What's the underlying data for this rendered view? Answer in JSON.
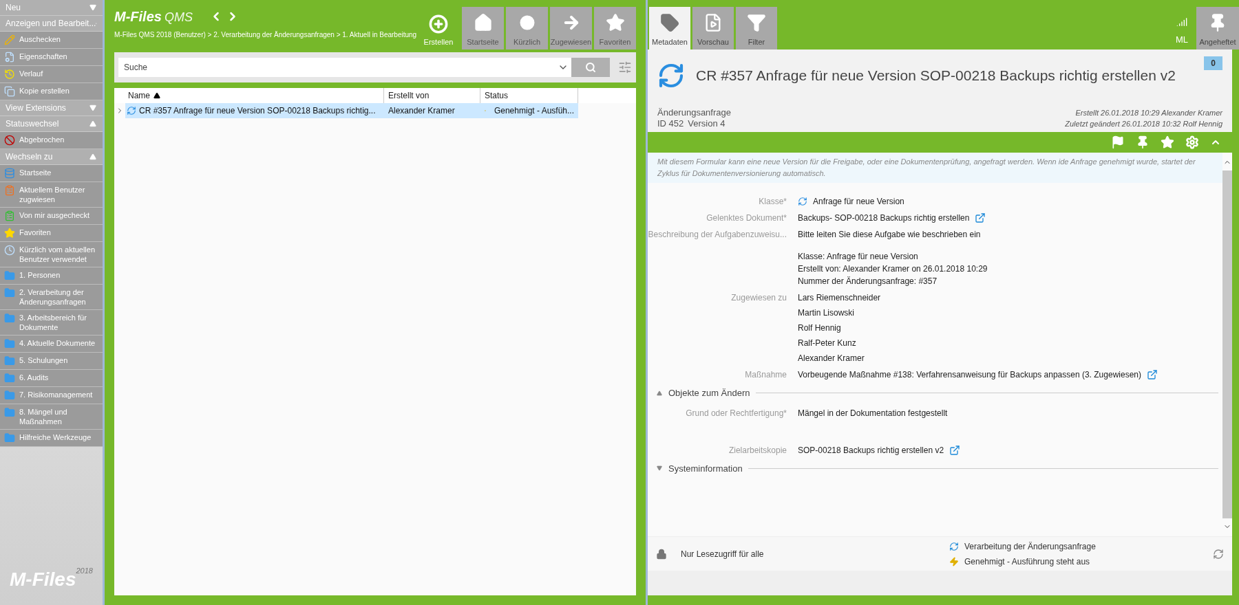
{
  "sidebar": {
    "sections": [
      {
        "title": "Neu",
        "expanded": false
      },
      {
        "title": "Anzeigen und Bearbeit...",
        "expanded": true,
        "items": [
          {
            "label": "Auschecken",
            "kind": "edit"
          },
          {
            "label": "Eigenschaften",
            "kind": "properties"
          },
          {
            "label": "Verlauf",
            "kind": "history"
          },
          {
            "label": "Kopie erstellen",
            "kind": "copy"
          }
        ]
      },
      {
        "title": "View Extensions",
        "expanded": false
      },
      {
        "title": "Statuswechsel",
        "expanded": true,
        "items": [
          {
            "label": "Abgebrochen",
            "kind": "cancel"
          }
        ]
      },
      {
        "title": "Wechseln zu",
        "expanded": true,
        "items": [
          {
            "label": "Startseite",
            "kind": "home"
          },
          {
            "label": "Aktuellem Benutzer zugwiesen",
            "kind": "assigned"
          },
          {
            "label": "Von mir ausgecheckt",
            "kind": "checked_out"
          },
          {
            "label": "Favoriten",
            "kind": "favorite"
          },
          {
            "label": "Kürzlich vom aktuellen Benutzer verwendet",
            "kind": "recent"
          },
          {
            "label": "1. Personen",
            "kind": "folder"
          },
          {
            "label": "2. Verarbeitung der Änderungsanfragen",
            "kind": "folder"
          },
          {
            "label": "3. Arbeitsbereich für Dokumente",
            "kind": "folder"
          },
          {
            "label": "4. Aktuelle Dokumente",
            "kind": "folder"
          },
          {
            "label": "5. Schulungen",
            "kind": "folder"
          },
          {
            "label": "6. Audits",
            "kind": "folder"
          },
          {
            "label": "7. Risikomanagement",
            "kind": "folder"
          },
          {
            "label": "8. Mängel und Maßnahmen",
            "kind": "folder"
          },
          {
            "label": "Hilfreiche Werkzeuge",
            "kind": "folder"
          }
        ]
      }
    ],
    "brand": "M-Files",
    "brand_year": "2018"
  },
  "header": {
    "logo": "M-Files",
    "product": "QMS",
    "breadcrumb": "M-Files QMS 2018 (Benutzer) > 2. Verarbeitung der Änderungsanfragen > 1. Aktuell in Bearbeitung",
    "create": "Erstellen",
    "tabs": [
      {
        "label": "Startseite",
        "kind": "home",
        "selected": false
      },
      {
        "label": "Kürzlich",
        "kind": "recent",
        "selected": false
      },
      {
        "label": "Zugewiesen",
        "kind": "assigned",
        "selected": false
      },
      {
        "label": "Favoriten",
        "kind": "favorite",
        "selected": false
      }
    ]
  },
  "search": {
    "placeholder": "Suche"
  },
  "table": {
    "columns": [
      {
        "label": "Name",
        "sorted": true
      },
      {
        "label": "Erstellt von",
        "sorted": false
      },
      {
        "label": "Status",
        "sorted": false
      }
    ],
    "rows": [
      {
        "name": "CR #357 Anfrage für neue Version SOP-00218 Backups richtig...",
        "created_by": "Alexander Kramer",
        "status": "Genehmigt - Ausfüh...",
        "selected": true
      }
    ]
  },
  "details": {
    "tabs": [
      {
        "label": "Metadaten",
        "kind": "tag",
        "selected": true
      },
      {
        "label": "Vorschau",
        "kind": "preview",
        "selected": false
      },
      {
        "label": "Filter",
        "kind": "filter",
        "selected": false
      }
    ],
    "user": "ML",
    "pinned": {
      "label": "Angeheftet",
      "selected": false
    },
    "title": "CR #357 Anfrage für neue Version SOP-00218 Backups richtig erstellen v2",
    "comments": "0",
    "object_type": "Änderungsanfrage",
    "id": "ID 452",
    "version": "Version 4",
    "created": "Erstellt 26.01.2018 10:29 Alexander Kramer",
    "modified": "Zuletzt geändert 26.01.2018 10:32 Rolf Hennig",
    "description": "Mit diesem Formular kann eine neue Version für die Freigabe, oder eine Dokumentenprüfung, angefragt werden. Wenn ide Anfrage genehmigt wurde, startet der Zyklus für Dokumentenversionierung automatisch.",
    "properties": [
      {
        "label": "Klasse*",
        "kind": "class",
        "paragraphs": [
          [
            "Anfrage für neue Version"
          ]
        ],
        "link": false
      },
      {
        "label": "Gelenktes Dokument*",
        "paragraphs": [
          [
            "Backups- SOP-00218 Backups richtig erstellen"
          ]
        ],
        "link": true
      },
      {
        "label": "Beschreibung der Aufgabenzuweisu...",
        "paragraphs": [
          [
            "Bitte leiten Sie diese Aufgabe wie beschrieben ein"
          ],
          [
            "Klasse: Anfrage für neue Version",
            "Erstellt von: Alexander Kramer on 26.01.2018 10:29",
            "Nummer der Änderungsanfrage: #357"
          ]
        ],
        "link": false
      },
      {
        "label": "Zugewiesen zu",
        "list": [
          "Lars Riemenschneider",
          "Martin Lisowski",
          "Rolf Hennig",
          "Ralf-Peter Kunz",
          "Alexander Kramer"
        ],
        "link": false
      },
      {
        "label": "Maßnahme",
        "paragraphs": [
          [
            "Vorbeugende Maßnahme #138: Verfahrensanweisung für Backups anpassen (3. Zugewiesen)"
          ]
        ],
        "link": true
      }
    ],
    "sections": [
      {
        "title": "Objekte zum Ändern",
        "expanded": true,
        "properties": [
          {
            "label": "Grund oder Rechtfertigung*",
            "paragraphs": [
              [
                "Mängel in der Dokumentation festgestellt"
              ]
            ],
            "link": false
          },
          {
            "label": "Zielarbeitskopie",
            "paragraphs": [
              [
                "SOP-00218 Backups richtig erstellen v2"
              ]
            ],
            "link": true
          }
        ]
      },
      {
        "title": "Systeminformation",
        "expanded": false
      }
    ],
    "footer": {
      "permission": "Nur Lesezugriff für alle",
      "workflow": "Verarbeitung der Änderungsanfrage",
      "state": "Genehmigt - Ausführung steht aus"
    }
  }
}
